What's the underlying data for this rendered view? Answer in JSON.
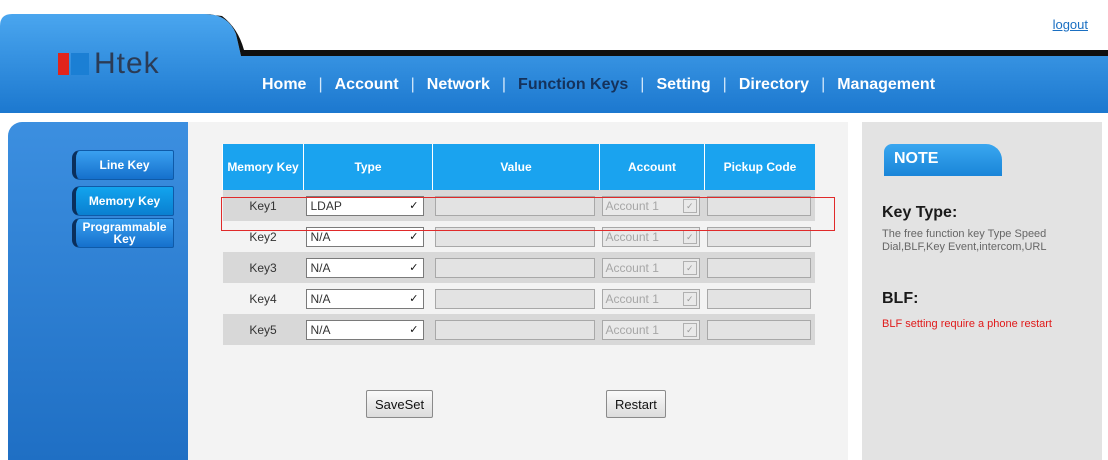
{
  "header": {
    "logout": "logout",
    "logo_text": "Htek"
  },
  "nav": {
    "items": [
      {
        "label": "Home"
      },
      {
        "label": "Account"
      },
      {
        "label": "Network"
      },
      {
        "label": "Function Keys"
      },
      {
        "label": "Setting"
      },
      {
        "label": "Directory"
      },
      {
        "label": "Management"
      }
    ],
    "active": "Function Keys"
  },
  "sidebar": {
    "items": [
      {
        "label": "Line Key"
      },
      {
        "label": "Memory Key"
      },
      {
        "label": "Programmable Key"
      }
    ],
    "active": "Memory Key"
  },
  "table": {
    "headers": [
      "Memory Key",
      "Type",
      "Value",
      "Account",
      "Pickup Code"
    ],
    "rows": [
      {
        "key": "Key1",
        "type": "LDAP",
        "value": "",
        "account": "Account 1",
        "pickup": ""
      },
      {
        "key": "Key2",
        "type": "N/A",
        "value": "",
        "account": "Account 1",
        "pickup": ""
      },
      {
        "key": "Key3",
        "type": "N/A",
        "value": "",
        "account": "Account 1",
        "pickup": ""
      },
      {
        "key": "Key4",
        "type": "N/A",
        "value": "",
        "account": "Account 1",
        "pickup": ""
      },
      {
        "key": "Key5",
        "type": "N/A",
        "value": "",
        "account": "Account 1",
        "pickup": ""
      }
    ]
  },
  "buttons": {
    "save": "SaveSet",
    "restart": "Restart"
  },
  "note": {
    "tab": "NOTE",
    "key_type_title": "Key Type:",
    "key_type_text": "The free function key Type Speed Dial,BLF,Key Event,intercom,URL",
    "blf_title": "BLF:",
    "blf_text": "BLF setting require a phone restart"
  },
  "colors": {
    "brand_blue": "#1aa3ef",
    "highlight_red": "#e02a2a",
    "logo_red": "#e1241b",
    "logo_blue": "#1b7fd4"
  }
}
